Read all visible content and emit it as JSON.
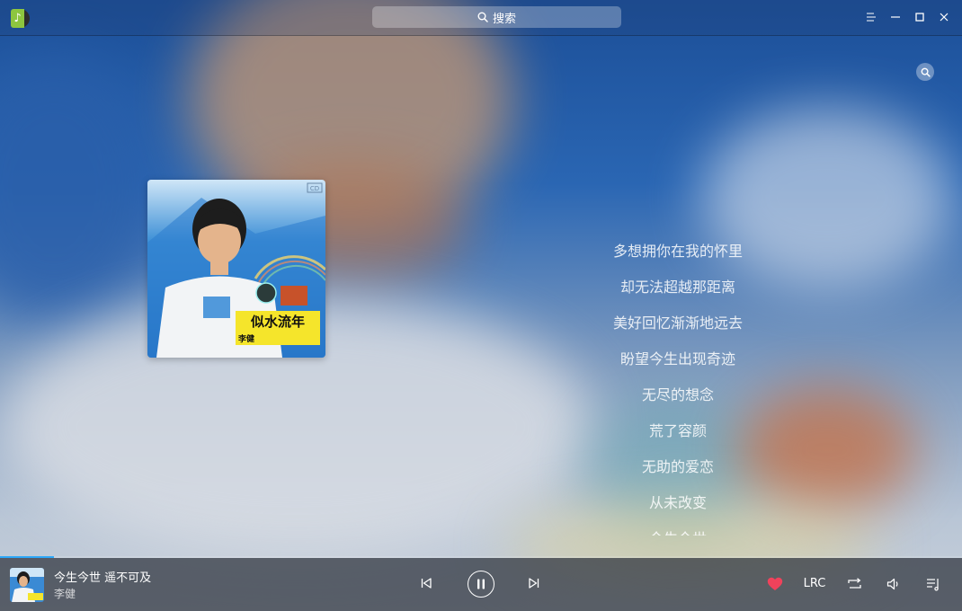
{
  "titlebar": {
    "search_label": "搜索"
  },
  "lyrics": {
    "lines": [
      "多想拥你在我的怀里",
      "却无法超越那距离",
      "美好回忆渐渐地远去",
      "盼望今生出现奇迹",
      "无尽的想念",
      "荒了容颜",
      "无助的爱恋",
      "从未改变",
      "今生今世"
    ]
  },
  "album": {
    "cover_title": "似水流年",
    "cover_artist": "李健",
    "cover_badge": "CD"
  },
  "player": {
    "song_title": "今生今世 遥不可及",
    "artist": "李健",
    "lrc_label": "LRC",
    "progress": 0.056,
    "liked": true
  },
  "colors": {
    "progress": "#2ca7f8",
    "heart": "#f0425b",
    "logo_green": "#8dc63f"
  }
}
